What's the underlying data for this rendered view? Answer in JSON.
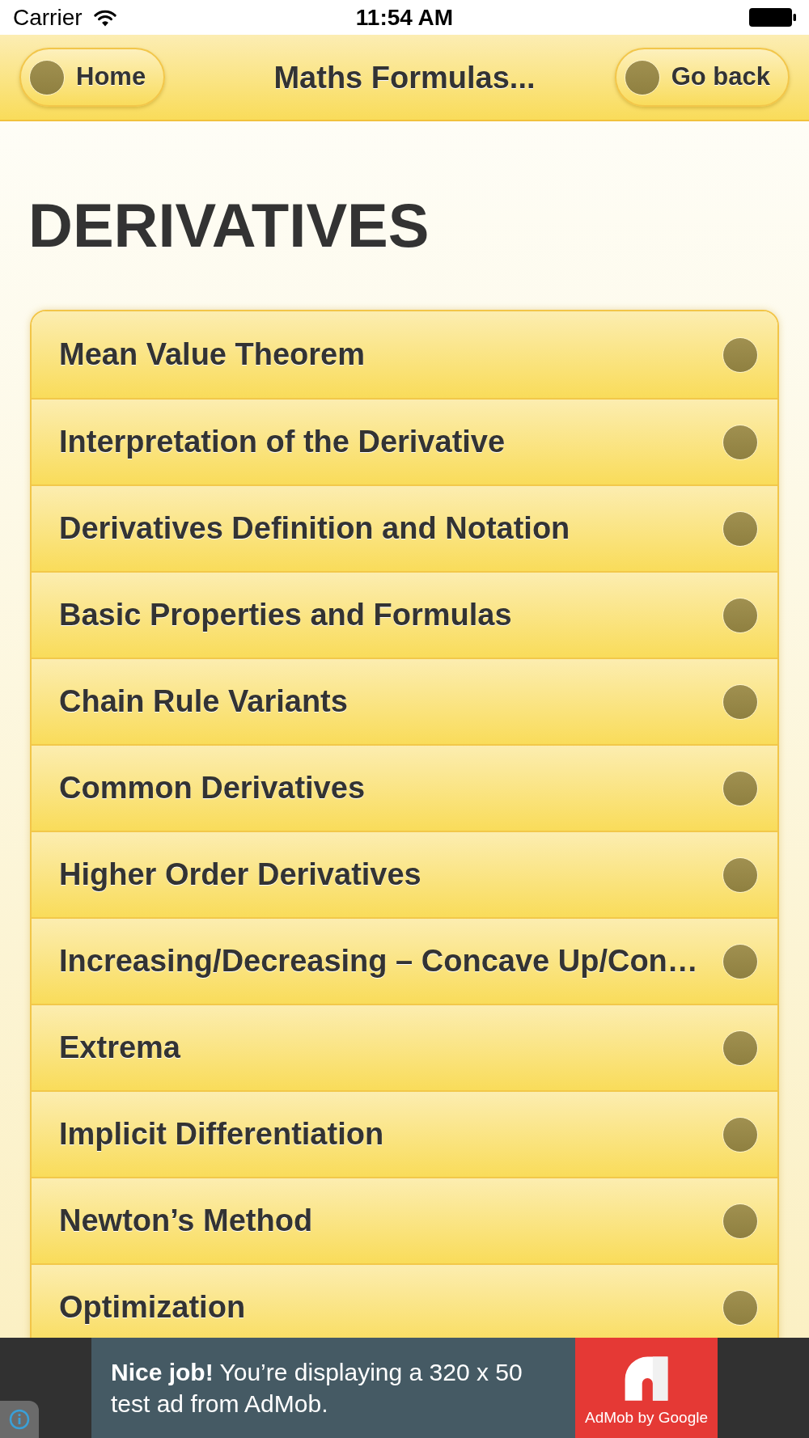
{
  "status_bar": {
    "carrier": "Carrier",
    "time": "11:54 AM"
  },
  "header": {
    "home_button": "Home",
    "title": "Maths Formulas...",
    "back_button": "Go back"
  },
  "page": {
    "heading": "DERIVATIVES",
    "items": [
      "Mean Value Theorem",
      "Interpretation of the Derivative",
      "Derivatives Definition and Notation",
      "Basic Properties and Formulas",
      "Chain Rule Variants",
      "Common Derivatives",
      "Higher Order Derivatives",
      "Increasing/Decreasing – Concave Up/Con…",
      "Extrema",
      "Implicit Differentiation",
      "Newton’s Method",
      "Optimization"
    ]
  },
  "ad_banner": {
    "text": "**Nice job!** You’re displaying a 320 x 50 test ad from AdMob.",
    "brand": "AdMob by Google"
  }
}
